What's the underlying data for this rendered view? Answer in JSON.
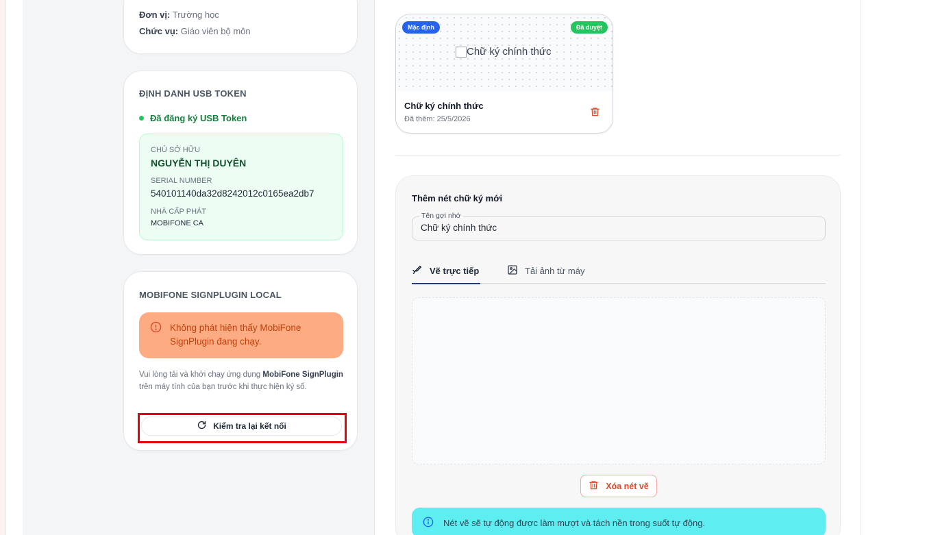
{
  "profile": {
    "unit_label": "Đơn vị:",
    "unit_value": "Trường học",
    "position_label": "Chức vụ:",
    "position_value": "Giáo viên bộ môn"
  },
  "usb_token": {
    "title": "ĐỊNH DANH USB TOKEN",
    "status": "Đã đăng ký USB Token",
    "owner_label": "CHỦ SỞ HỮU",
    "owner_value": "NGUYỄN THỊ DUYÊN",
    "serial_label": "SERIAL NUMBER",
    "serial_value": "540101140da32d8242012c0165ea2db7",
    "issuer_label": "NHÀ CẤP PHÁT",
    "issuer_value": "MOBIFONE CA"
  },
  "signplugin": {
    "title": "MOBIFONE SIGNPLUGIN LOCAL",
    "warning": "Không phát hiện thấy MobiFone SignPlugin đang chạy.",
    "desc_prefix": "Vui lòng tải và khởi chạy ứng dụng ",
    "desc_app": "MobiFone SignPlugin",
    "desc_suffix": " trên máy tính của bạn trước khi thực hiện ký số.",
    "recheck_label": "Kiểm tra lại kết nối"
  },
  "signature_card": {
    "badge_default": "Mặc định",
    "badge_approved": "Đã duyệt",
    "image_alt": "Chữ ký chính thức",
    "name": "Chữ ký chính thức",
    "added": "Đã thêm: 25/5/2026"
  },
  "new_signature": {
    "title": "Thêm nét chữ ký mới",
    "name_label": "Tên gợi nhớ",
    "name_value": "Chữ ký chính thức",
    "tab_draw": "Vẽ trực tiếp",
    "tab_upload": "Tải ảnh từ máy",
    "clear_label": "Xóa nét vẽ",
    "info": "Nét vẽ sẽ tự động được làm mượt và tách nền trong suốt tự động."
  },
  "colors": {
    "accent_blue": "#2563eb",
    "success_green": "#22c55e",
    "warning_orange": "#fdab83",
    "danger_red": "#dc4a2a",
    "info_cyan": "#5eeef2",
    "highlight_red": "#e20010"
  },
  "icons": {
    "status": "dot-icon",
    "warning": "alert-circle-icon",
    "recheck": "refresh-icon",
    "delete": "trash-icon",
    "draw": "pen-icon",
    "upload": "image-icon",
    "info": "info-icon"
  }
}
